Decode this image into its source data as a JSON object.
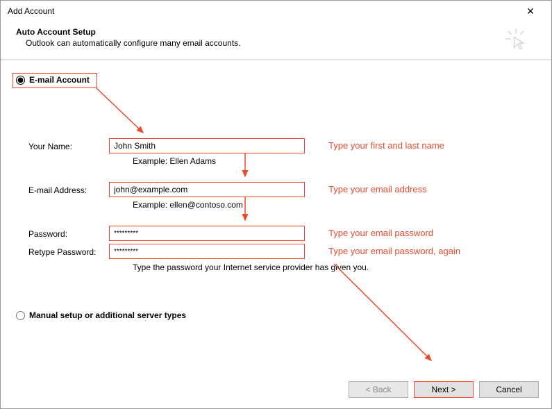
{
  "title": "Add Account",
  "header": {
    "title": "Auto Account Setup",
    "subtitle": "Outlook can automatically configure many email accounts."
  },
  "radios": {
    "email": "E-mail Account",
    "manual": "Manual setup or additional server types"
  },
  "fields": {
    "name_label": "Your Name:",
    "name_value": "John Smith",
    "name_example": "Example: Ellen Adams",
    "email_label": "E-mail Address:",
    "email_value": "john@example.com",
    "email_example": "Example: ellen@contoso.com",
    "password_label": "Password:",
    "password_value": "*********",
    "retype_label": "Retype Password:",
    "retype_value": "*********",
    "password_hint": "Type the password your Internet service provider has given you."
  },
  "annotations": {
    "name": "Type your first and last name",
    "email": "Type your email address",
    "password": "Type your email password",
    "retype": "Type your email password, again"
  },
  "buttons": {
    "back": "< Back",
    "next": "Next >",
    "cancel": "Cancel"
  }
}
